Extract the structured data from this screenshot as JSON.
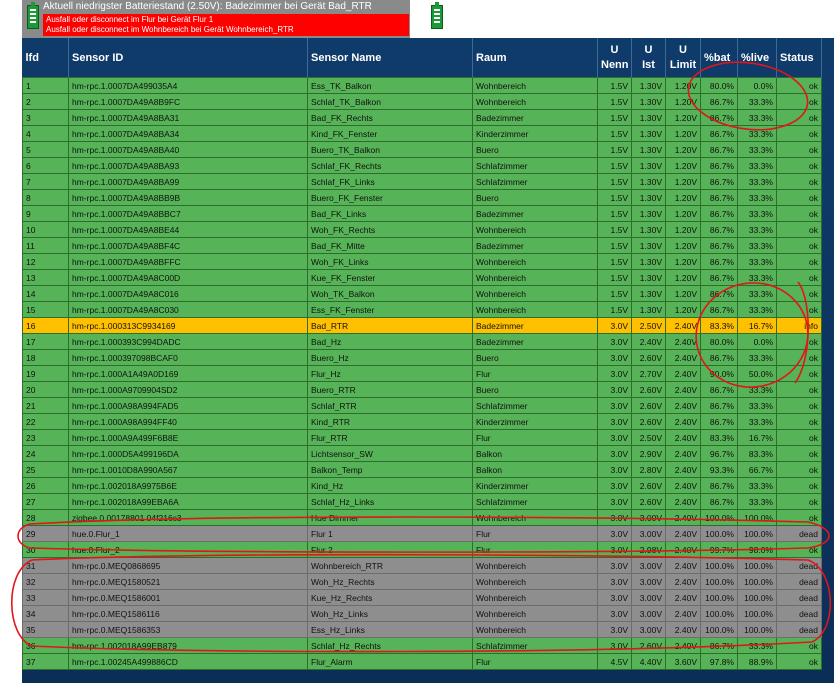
{
  "header": {
    "title": "Aktuell niedrigster Batteriestand (2.50V): Badezimmer bei Gerät Bad_RTR",
    "alerts": [
      "Ausfall oder disconnect im Flur bei Gerät Flur 1",
      "Ausfall oder disconnect im Wohnbereich bei Gerät Wohnbereich_RTR"
    ],
    "icons": [
      "battery-icon",
      "battery-icon"
    ]
  },
  "table": {
    "columns": [
      "lfd",
      "Sensor ID",
      "Sensor Name",
      "Raum",
      "U Nenn",
      "U Ist",
      "U Limit",
      "%bat",
      "%live",
      "Status"
    ],
    "rows": [
      {
        "lfd": "1",
        "id": "hm-rpc.1.0007DA499035A4",
        "name": "Ess_TK_Balkon",
        "room": "Wohnbereich",
        "unenn": "1.5V",
        "uist": "1.30V",
        "ulimit": "1.20V",
        "bat": "80.0%",
        "live": "0.0%",
        "status": "ok",
        "state": "green"
      },
      {
        "lfd": "2",
        "id": "hm-rpc.1.0007DA49A8B9FC",
        "name": "Schlaf_TK_Balkon",
        "room": "Wohnbereich",
        "unenn": "1.5V",
        "uist": "1.30V",
        "ulimit": "1.20V",
        "bat": "86.7%",
        "live": "33.3%",
        "status": "ok",
        "state": "green"
      },
      {
        "lfd": "3",
        "id": "hm-rpc.1.0007DA49A8BA31",
        "name": "Bad_FK_Rechts",
        "room": "Badezimmer",
        "unenn": "1.5V",
        "uist": "1.30V",
        "ulimit": "1.20V",
        "bat": "86.7%",
        "live": "33.3%",
        "status": "ok",
        "state": "green"
      },
      {
        "lfd": "4",
        "id": "hm-rpc.1.0007DA49A8BA34",
        "name": "Kind_FK_Fenster",
        "room": "Kinderzimmer",
        "unenn": "1.5V",
        "uist": "1.30V",
        "ulimit": "1.20V",
        "bat": "86.7%",
        "live": "33.3%",
        "status": "ok",
        "state": "green"
      },
      {
        "lfd": "5",
        "id": "hm-rpc.1.0007DA49A8BA40",
        "name": "Buero_TK_Balkon",
        "room": "Buero",
        "unenn": "1.5V",
        "uist": "1.30V",
        "ulimit": "1.20V",
        "bat": "86.7%",
        "live": "33.3%",
        "status": "ok",
        "state": "green"
      },
      {
        "lfd": "6",
        "id": "hm-rpc.1.0007DA49A8BA93",
        "name": "Schlaf_FK_Rechts",
        "room": "Schlafzimmer",
        "unenn": "1.5V",
        "uist": "1.30V",
        "ulimit": "1.20V",
        "bat": "86.7%",
        "live": "33.3%",
        "status": "ok",
        "state": "green"
      },
      {
        "lfd": "7",
        "id": "hm-rpc.1.0007DA49A8BA99",
        "name": "Schlaf_FK_Links",
        "room": "Schlafzimmer",
        "unenn": "1.5V",
        "uist": "1.30V",
        "ulimit": "1.20V",
        "bat": "86.7%",
        "live": "33.3%",
        "status": "ok",
        "state": "green"
      },
      {
        "lfd": "8",
        "id": "hm-rpc.1.0007DA49A8BB9B",
        "name": "Buero_FK_Fenster",
        "room": "Buero",
        "unenn": "1.5V",
        "uist": "1.30V",
        "ulimit": "1.20V",
        "bat": "86.7%",
        "live": "33.3%",
        "status": "ok",
        "state": "green"
      },
      {
        "lfd": "9",
        "id": "hm-rpc.1.0007DA49A8BBC7",
        "name": "Bad_FK_Links",
        "room": "Badezimmer",
        "unenn": "1.5V",
        "uist": "1.30V",
        "ulimit": "1.20V",
        "bat": "86.7%",
        "live": "33.3%",
        "status": "ok",
        "state": "green"
      },
      {
        "lfd": "10",
        "id": "hm-rpc.1.0007DA49A8BE44",
        "name": "Woh_FK_Rechts",
        "room": "Wohnbereich",
        "unenn": "1.5V",
        "uist": "1.30V",
        "ulimit": "1.20V",
        "bat": "86.7%",
        "live": "33.3%",
        "status": "ok",
        "state": "green"
      },
      {
        "lfd": "11",
        "id": "hm-rpc.1.0007DA49A8BF4C",
        "name": "Bad_FK_Mitte",
        "room": "Badezimmer",
        "unenn": "1.5V",
        "uist": "1.30V",
        "ulimit": "1.20V",
        "bat": "86.7%",
        "live": "33.3%",
        "status": "ok",
        "state": "green"
      },
      {
        "lfd": "12",
        "id": "hm-rpc.1.0007DA49A8BFFC",
        "name": "Woh_FK_Links",
        "room": "Wohnbereich",
        "unenn": "1.5V",
        "uist": "1.30V",
        "ulimit": "1.20V",
        "bat": "86.7%",
        "live": "33.3%",
        "status": "ok",
        "state": "green"
      },
      {
        "lfd": "13",
        "id": "hm-rpc.1.0007DA49A8C00D",
        "name": "Kue_FK_Fenster",
        "room": "Wohnbereich",
        "unenn": "1.5V",
        "uist": "1.30V",
        "ulimit": "1.20V",
        "bat": "86.7%",
        "live": "33.3%",
        "status": "ok",
        "state": "green"
      },
      {
        "lfd": "14",
        "id": "hm-rpc.1.0007DA49A8C016",
        "name": "Woh_TK_Balkon",
        "room": "Wohnbereich",
        "unenn": "1.5V",
        "uist": "1.30V",
        "ulimit": "1.20V",
        "bat": "86.7%",
        "live": "33.3%",
        "status": "ok",
        "state": "green"
      },
      {
        "lfd": "15",
        "id": "hm-rpc.1.0007DA49A8C030",
        "name": "Ess_FK_Fenster",
        "room": "Wohnbereich",
        "unenn": "1.5V",
        "uist": "1.30V",
        "ulimit": "1.20V",
        "bat": "86.7%",
        "live": "33.3%",
        "status": "ok",
        "state": "green"
      },
      {
        "lfd": "16",
        "id": "hm-rpc.1.000313C9934169",
        "name": "Bad_RTR",
        "room": "Badezimmer",
        "unenn": "3.0V",
        "uist": "2.50V",
        "ulimit": "2.40V",
        "bat": "83.3%",
        "live": "16.7%",
        "status": "info",
        "state": "yellow"
      },
      {
        "lfd": "17",
        "id": "hm-rpc.1.000393C994DADC",
        "name": "Bad_Hz",
        "room": "Badezimmer",
        "unenn": "3.0V",
        "uist": "2.40V",
        "ulimit": "2.40V",
        "bat": "80.0%",
        "live": "0.0%",
        "status": "ok",
        "state": "green"
      },
      {
        "lfd": "18",
        "id": "hm-rpc.1.000397098BCAF0",
        "name": "Buero_Hz",
        "room": "Buero",
        "unenn": "3.0V",
        "uist": "2.60V",
        "ulimit": "2.40V",
        "bat": "86.7%",
        "live": "33.3%",
        "status": "ok",
        "state": "green"
      },
      {
        "lfd": "19",
        "id": "hm-rpc.1.000A1A49A0D169",
        "name": "Flur_Hz",
        "room": "Flur",
        "unenn": "3.0V",
        "uist": "2.70V",
        "ulimit": "2.40V",
        "bat": "90.0%",
        "live": "50.0%",
        "status": "ok",
        "state": "green"
      },
      {
        "lfd": "20",
        "id": "hm-rpc.1.000A9709904SD2",
        "name": "Buero_RTR",
        "room": "Buero",
        "unenn": "3.0V",
        "uist": "2.60V",
        "ulimit": "2.40V",
        "bat": "86.7%",
        "live": "33.3%",
        "status": "ok",
        "state": "green"
      },
      {
        "lfd": "21",
        "id": "hm-rpc.1.000A98A994FAD5",
        "name": "Schlaf_RTR",
        "room": "Schlafzimmer",
        "unenn": "3.0V",
        "uist": "2.60V",
        "ulimit": "2.40V",
        "bat": "86.7%",
        "live": "33.3%",
        "status": "ok",
        "state": "green"
      },
      {
        "lfd": "22",
        "id": "hm-rpc.1.000A98A994FF40",
        "name": "Kind_RTR",
        "room": "Kinderzimmer",
        "unenn": "3.0V",
        "uist": "2.60V",
        "ulimit": "2.40V",
        "bat": "86.7%",
        "live": "33.3%",
        "status": "ok",
        "state": "green"
      },
      {
        "lfd": "23",
        "id": "hm-rpc.1.000A9A499F6B8E",
        "name": "Flur_RTR",
        "room": "Flur",
        "unenn": "3.0V",
        "uist": "2.50V",
        "ulimit": "2.40V",
        "bat": "83.3%",
        "live": "16.7%",
        "status": "ok",
        "state": "green"
      },
      {
        "lfd": "24",
        "id": "hm-rpc.1.000D5A499196DA",
        "name": "Lichtsensor_SW",
        "room": "Balkon",
        "unenn": "3.0V",
        "uist": "2.90V",
        "ulimit": "2.40V",
        "bat": "96.7%",
        "live": "83.3%",
        "status": "ok",
        "state": "green"
      },
      {
        "lfd": "25",
        "id": "hm-rpc.1.0010D8A990A567",
        "name": "Balkon_Temp",
        "room": "Balkon",
        "unenn": "3.0V",
        "uist": "2.80V",
        "ulimit": "2.40V",
        "bat": "93.3%",
        "live": "66.7%",
        "status": "ok",
        "state": "green"
      },
      {
        "lfd": "26",
        "id": "hm-rpc.1.002018A9975B6E",
        "name": "Kind_Hz",
        "room": "Kinderzimmer",
        "unenn": "3.0V",
        "uist": "2.60V",
        "ulimit": "2.40V",
        "bat": "86.7%",
        "live": "33.3%",
        "status": "ok",
        "state": "green"
      },
      {
        "lfd": "27",
        "id": "hm-rpc.1.002018A99EBA6A",
        "name": "Schlaf_Hz_Links",
        "room": "Schlafzimmer",
        "unenn": "3.0V",
        "uist": "2.60V",
        "ulimit": "2.40V",
        "bat": "86.7%",
        "live": "33.3%",
        "status": "ok",
        "state": "green"
      },
      {
        "lfd": "28",
        "id": "zigbee.0.00178801 04f216c3",
        "name": "Hue Dimmer",
        "room": "Wohnbereich",
        "unenn": "3.0V",
        "uist": "3.00V",
        "ulimit": "2.40V",
        "bat": "100.0%",
        "live": "100.0%",
        "status": "ok",
        "state": "green"
      },
      {
        "lfd": "29",
        "id": "hue.0.Flur_1",
        "name": "Flur 1",
        "room": "Flur",
        "unenn": "3.0V",
        "uist": "3.00V",
        "ulimit": "2.40V",
        "bat": "100.0%",
        "live": "100.0%",
        "status": "dead",
        "state": "gray"
      },
      {
        "lfd": "30",
        "id": "hue.0.Flur_2",
        "name": "Flur 2",
        "room": "Flur",
        "unenn": "3.0V",
        "uist": "2.98V",
        "ulimit": "2.40V",
        "bat": "99.7%",
        "live": "98.0%",
        "status": "ok",
        "state": "green"
      },
      {
        "lfd": "31",
        "id": "hm-rpc.0.MEQ0868695",
        "name": "Wohnbereich_RTR",
        "room": "Wohnbereich",
        "unenn": "3.0V",
        "uist": "3.00V",
        "ulimit": "2.40V",
        "bat": "100.0%",
        "live": "100.0%",
        "status": "dead",
        "state": "gray"
      },
      {
        "lfd": "32",
        "id": "hm-rpc.0.MEQ1580521",
        "name": "Woh_Hz_Rechts",
        "room": "Wohnbereich",
        "unenn": "3.0V",
        "uist": "3.00V",
        "ulimit": "2.40V",
        "bat": "100.0%",
        "live": "100.0%",
        "status": "dead",
        "state": "gray"
      },
      {
        "lfd": "33",
        "id": "hm-rpc.0.MEQ1586001",
        "name": "Kue_Hz_Rechts",
        "room": "Wohnbereich",
        "unenn": "3.0V",
        "uist": "3.00V",
        "ulimit": "2.40V",
        "bat": "100.0%",
        "live": "100.0%",
        "status": "dead",
        "state": "gray"
      },
      {
        "lfd": "34",
        "id": "hm-rpc.0.MEQ1586116",
        "name": "Woh_Hz_Links",
        "room": "Wohnbereich",
        "unenn": "3.0V",
        "uist": "3.00V",
        "ulimit": "2.40V",
        "bat": "100.0%",
        "live": "100.0%",
        "status": "dead",
        "state": "gray"
      },
      {
        "lfd": "35",
        "id": "hm-rpc.0.MEQ1586353",
        "name": "Ess_Hz_Links",
        "room": "Wohnbereich",
        "unenn": "3.0V",
        "uist": "3.00V",
        "ulimit": "2.40V",
        "bat": "100.0%",
        "live": "100.0%",
        "status": "dead",
        "state": "gray"
      },
      {
        "lfd": "36",
        "id": "hm-rpc.1.002018A99EB879",
        "name": "Schlaf_Hz_Rechts",
        "room": "Schlafzimmer",
        "unenn": "3.0V",
        "uist": "2.60V",
        "ulimit": "2.40V",
        "bat": "86.7%",
        "live": "33.3%",
        "status": "ok",
        "state": "green"
      },
      {
        "lfd": "37",
        "id": "hm-rpc.1.00245A499886CD",
        "name": "Flur_Alarm",
        "room": "Flur",
        "unenn": "4.5V",
        "uist": "4.40V",
        "ulimit": "3.60V",
        "bat": "97.8%",
        "live": "88.9%",
        "status": "ok",
        "state": "green"
      }
    ]
  },
  "colors": {
    "row_ok": "#57b357",
    "row_info": "#ffc000",
    "row_dead": "#8e8e8e",
    "alert": "#ff0000",
    "annotation": "#e0161b"
  }
}
